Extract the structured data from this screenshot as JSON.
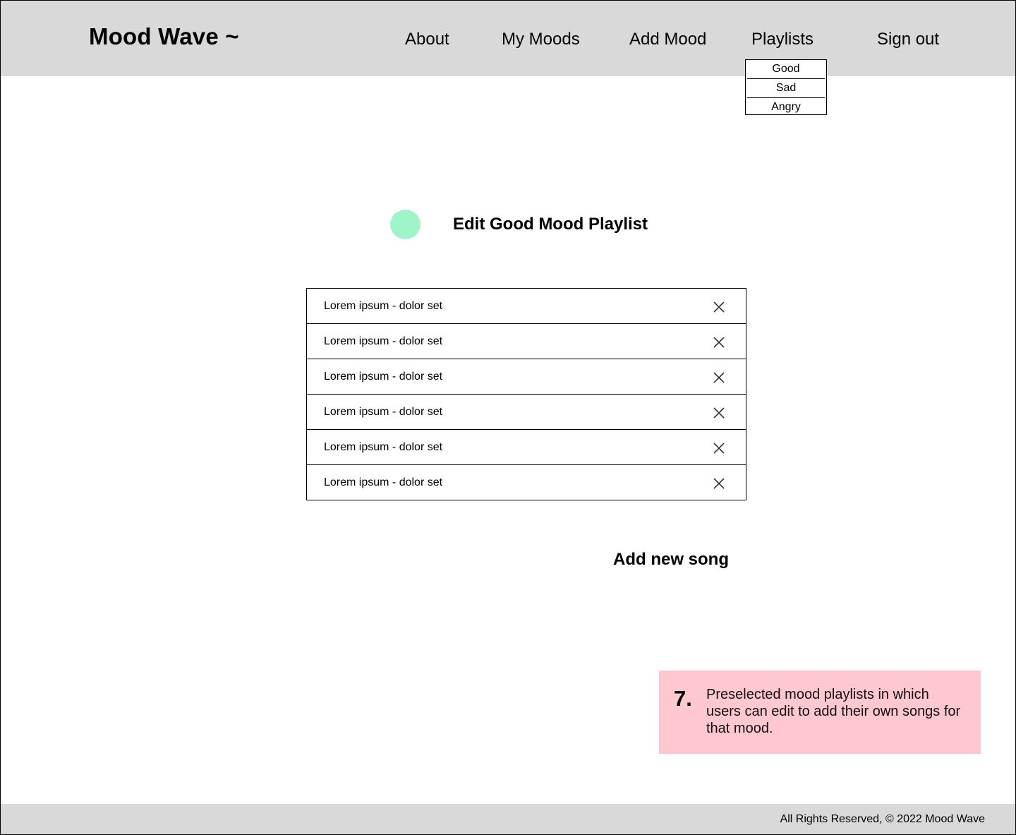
{
  "header": {
    "brand": "Mood Wave ~",
    "nav": {
      "about": "About",
      "my_moods": "My Moods",
      "add_mood": "Add Mood",
      "playlists": "Playlists",
      "sign_out": "Sign out"
    },
    "playlists_dropdown": [
      "Good",
      "Sad",
      "Angry"
    ]
  },
  "main": {
    "mood_color": "#9ef5c8",
    "title": "Edit Good Mood Playlist",
    "songs": [
      "Lorem ipsum - dolor set",
      "Lorem ipsum - dolor set",
      "Lorem ipsum - dolor set",
      "Lorem ipsum - dolor set",
      "Lorem ipsum - dolor set",
      "Lorem ipsum - dolor set"
    ],
    "remove_icon": "close-icon",
    "add_song_label": "Add new song"
  },
  "annotation": {
    "number": "7.",
    "text": "Preselected mood playlists in which users can edit to add their own songs for that mood.",
    "background": "#ffc7ce"
  },
  "footer": {
    "text": "All Rights Reserved, © 2022 Mood Wave"
  }
}
